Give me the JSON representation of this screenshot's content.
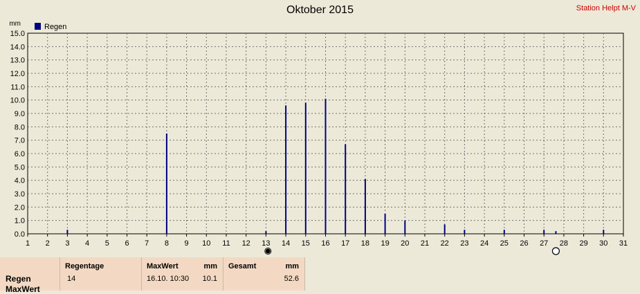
{
  "header": {
    "title": "Oktober 2015",
    "station": "Station Helpt M-V"
  },
  "chart_data": {
    "type": "bar",
    "title": "Oktober 2015",
    "ylabel": "mm",
    "ylim": [
      0,
      15
    ],
    "y_ticks": [
      "0.0",
      "1.0",
      "2.0",
      "3.0",
      "4.0",
      "5.0",
      "6.0",
      "7.0",
      "8.0",
      "9.0",
      "10.0",
      "11.0",
      "12.0",
      "13.0",
      "14.0",
      "15.0"
    ],
    "xlim": [
      1,
      31
    ],
    "x_ticks": [
      1,
      2,
      3,
      4,
      5,
      6,
      7,
      8,
      9,
      10,
      11,
      12,
      13,
      14,
      15,
      16,
      17,
      18,
      19,
      20,
      21,
      22,
      23,
      24,
      25,
      26,
      27,
      28,
      29,
      30,
      31
    ],
    "grid": true,
    "legend": "top-left",
    "series": [
      {
        "name": "Regen",
        "color": "#000080",
        "x": [
          3,
          8,
          13,
          14,
          15,
          16,
          17,
          18,
          19,
          20,
          22,
          23,
          25,
          27,
          27.6,
          30
        ],
        "values": [
          0.3,
          7.5,
          0.2,
          9.6,
          9.8,
          10.1,
          6.7,
          4.1,
          1.5,
          1.0,
          0.7,
          0.3,
          0.3,
          0.3,
          0.2,
          0.3
        ]
      }
    ],
    "moon_markers": [
      {
        "x": 13.1,
        "phase": "new-moon"
      },
      {
        "x": 27.6,
        "phase": "full-moon"
      }
    ]
  },
  "stats": {
    "rows": [
      "Regen",
      "MaxWert"
    ],
    "regentage": {
      "header": "Regentage",
      "value": "14"
    },
    "maxwert": {
      "header": "MaxWert",
      "unit": "mm",
      "datetime": "16.10.  10:30",
      "value": "10.1"
    },
    "gesamt": {
      "header": "Gesamt",
      "unit": "mm",
      "value": "52.6"
    }
  }
}
